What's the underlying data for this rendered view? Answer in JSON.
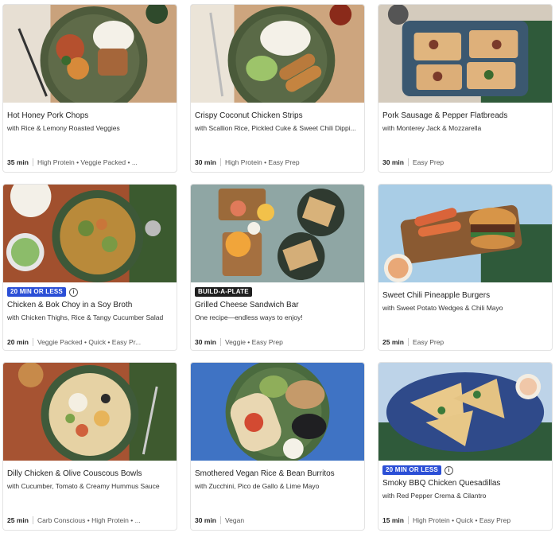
{
  "recipes": [
    {
      "title": "Hot Honey Pork Chops",
      "subtitle": "with Rice & Lemony Roasted Veggies",
      "time": "35 min",
      "tags": "High Protein • Veggie Packed • ..."
    },
    {
      "title": "Crispy Coconut Chicken Strips",
      "subtitle": "with Scallion Rice, Pickled Cuke & Sweet Chili Dippi...",
      "time": "30 min",
      "tags": "High Protein • Easy Prep"
    },
    {
      "title": "Pork Sausage & Pepper Flatbreads",
      "subtitle": "with Monterey Jack & Mozzarella",
      "time": "30 min",
      "tags": "Easy Prep"
    },
    {
      "badge": "20 MIN OR LESS",
      "title": "Chicken & Bok Choy in a Soy Broth",
      "subtitle": "with Chicken Thighs, Rice & Tangy Cucumber Salad",
      "time": "20 min",
      "tags": "Veggie Packed • Quick • Easy Pr..."
    },
    {
      "badge": "BUILD-A-PLATE",
      "title": "Grilled Cheese Sandwich Bar",
      "subtitle": "One recipe—endless ways to enjoy!",
      "time": "30 min",
      "tags": "Veggie • Easy Prep"
    },
    {
      "title": "Sweet Chili Pineapple Burgers",
      "subtitle": "with Sweet Potato Wedges & Chili Mayo",
      "time": "25 min",
      "tags": "Easy Prep"
    },
    {
      "title": "Dilly Chicken & Olive Couscous Bowls",
      "subtitle": "with Cucumber, Tomato & Creamy Hummus Sauce",
      "time": "25 min",
      "tags": "Carb Conscious • High Protein • ..."
    },
    {
      "title": "Smothered Vegan Rice & Bean Burritos",
      "subtitle": "with Zucchini, Pico de Gallo & Lime Mayo",
      "time": "30 min",
      "tags": "Vegan"
    },
    {
      "badge": "20 MIN OR LESS",
      "title": "Smoky BBQ Chicken Quesadillas",
      "subtitle": "with Red Pepper Crema & Cilantro",
      "time": "15 min",
      "tags": "High Protein • Quick • Easy Prep"
    }
  ],
  "badge_colors": {
    "20 MIN OR LESS": "#2b4fd6",
    "BUILD-A-PLATE": "#1f1f1f"
  },
  "info_icon": "i"
}
